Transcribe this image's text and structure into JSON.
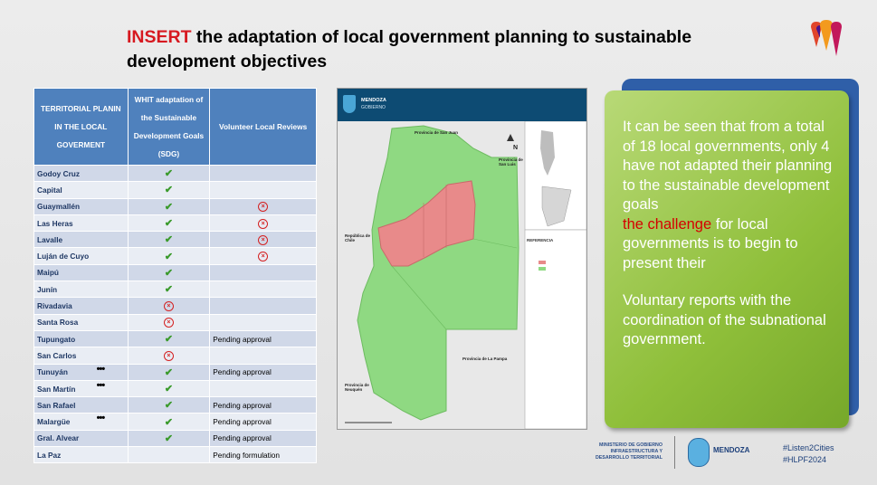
{
  "slide": {
    "title_accent": "INSERT",
    "title_rest": " the adaptation of local government planning to sustainable development objectives"
  },
  "table": {
    "headers": [
      "TERRITORIAL PLANIN IN THE LOCAL GOVERMENT",
      "WHIT adaptation of the Sustainable Development Goals (SDG)",
      "Volunteer Local Reviews"
    ],
    "rows": [
      {
        "name": "Godoy Cruz",
        "sdg": "check",
        "dots": false,
        "vlr": "",
        "vlr_icon": ""
      },
      {
        "name": "Capital",
        "sdg": "check",
        "dots": false,
        "vlr": "",
        "vlr_icon": ""
      },
      {
        "name": "Guaymallén",
        "sdg": "check",
        "dots": false,
        "vlr": "",
        "vlr_icon": "x"
      },
      {
        "name": "Las Heras",
        "sdg": "check",
        "dots": false,
        "vlr": "",
        "vlr_icon": "x"
      },
      {
        "name": "Lavalle",
        "sdg": "check",
        "dots": false,
        "vlr": "",
        "vlr_icon": "x"
      },
      {
        "name": "Luján de Cuyo",
        "sdg": "check",
        "dots": false,
        "vlr": "",
        "vlr_icon": "x"
      },
      {
        "name": "Maipú",
        "sdg": "check",
        "dots": false,
        "vlr": "",
        "vlr_icon": ""
      },
      {
        "name": "Junín",
        "sdg": "check",
        "dots": false,
        "vlr": "",
        "vlr_icon": ""
      },
      {
        "name": "Rivadavia",
        "sdg": "x",
        "dots": false,
        "vlr": "",
        "vlr_icon": ""
      },
      {
        "name": "Santa Rosa",
        "sdg": "x",
        "dots": false,
        "vlr": "",
        "vlr_icon": ""
      },
      {
        "name": " Tupungato",
        "sdg": "check",
        "dots": false,
        "vlr": "Pending approval",
        "vlr_icon": ""
      },
      {
        "name": "San Carlos",
        "sdg": "x",
        "dots": false,
        "vlr": "",
        "vlr_icon": ""
      },
      {
        "name": "Tunuyán",
        "sdg": "check",
        "dots": true,
        "vlr": "Pending approval",
        "vlr_icon": ""
      },
      {
        "name": "San Martín",
        "sdg": "check",
        "dots": true,
        "vlr": "",
        "vlr_icon": ""
      },
      {
        "name": "San Rafael",
        "sdg": "check",
        "dots": false,
        "vlr": "Pending approval",
        "vlr_icon": ""
      },
      {
        "name": "Malargüe",
        "sdg": "check",
        "dots": true,
        "vlr": "Pending approval",
        "vlr_icon": ""
      },
      {
        "name": "Gral. Alvear",
        "sdg": "check",
        "dots": false,
        "vlr": "Pending approval",
        "vlr_icon": ""
      },
      {
        "name": "La Paz",
        "sdg": "",
        "dots": false,
        "vlr": "Pending formulation",
        "vlr_icon": ""
      }
    ]
  },
  "map": {
    "header_title": "MENDOZA",
    "header_sub": "GOBIERNO",
    "label_san_juan": "Provincia de San Juan",
    "label_san_luis": "Provincia de San Luis",
    "label_chile": "República de Chile",
    "label_la_pampa": "Provincia de La Pampa",
    "label_neuquen": "Provincia de Neuquén",
    "legend_title": "REFERENCIA",
    "north": "N",
    "colors": {
      "adapted": "#8fd982",
      "not_adapted": "#e88a8a"
    }
  },
  "callout": {
    "line1": "It can be seen that from a total of 18 local governments, only 4 have not adapted their planning to the sustainable development goals",
    "challenge": "the challenge",
    "line2": " for local governments is to begin to present their",
    "line3": "Voluntary reports with the coordination of the subnational government."
  },
  "footer": {
    "ministry": "MINISTERIO DE GOBIERNO INFRAESTRUCTURA Y DESARROLLO TERRITORIAL",
    "mendoza": "MENDOZA",
    "tag1": "#Listen2Cities",
    "tag2": "#HLPF2024"
  }
}
